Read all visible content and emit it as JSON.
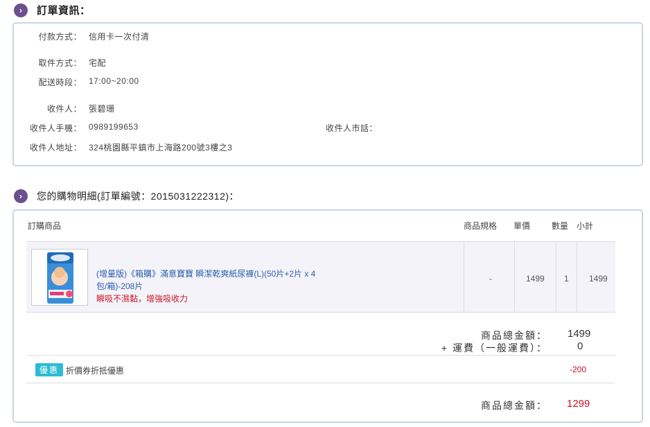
{
  "order_info": {
    "title": "訂單資訊：",
    "payment_label": "付款方式：",
    "payment_value": "信用卡一次付清",
    "pickup_label": "取件方式：",
    "pickup_value": "宅配",
    "delivery_time_label": "配送時段：",
    "delivery_time_value": "17:00~20:00",
    "recipient_label": "收件人：",
    "recipient_value": "張碧珊",
    "mobile_label": "收件人手機：",
    "mobile_value": "0989199653",
    "phone_label": "收件人市話：",
    "phone_value": "",
    "address_label": "收件人地址：",
    "address_value": "324桃園縣平鎮市上海路200號3樓之3"
  },
  "cart": {
    "title": "您的購物明細(訂單編號：2015031222312)：",
    "headers": {
      "product": "訂購商品",
      "spec": "商品規格",
      "unit_price": "單價",
      "qty": "數量",
      "subtotal": "小計"
    },
    "items": [
      {
        "name": "(增量版)《箱購》滿意寶寶 瞬潔乾爽紙尿褲(L)(50片+2片 x 4包/箱)-208片",
        "promo": "瞬吸不濕黏，增強吸收力",
        "spec": "-",
        "unit_price": "1499",
        "qty": "1",
        "subtotal": "1499"
      }
    ],
    "summary": {
      "goods_total_label": "商品總金額：",
      "goods_total_value": "1499",
      "shipping_label": "+ 運費（一般運費）：",
      "shipping_value": "0"
    },
    "discount": {
      "badge": "優惠",
      "text": "折價券折抵優惠",
      "value": "-200"
    },
    "grand_total_label": "商品總金額：",
    "grand_total_value": "1299"
  },
  "colors": {
    "section_icon": "#6b4f8f",
    "box_border": "#c9d5e2",
    "link_blue": "#2a5fb0",
    "alert_red": "#c8142a",
    "badge_cyan": "#2bbcd4"
  }
}
